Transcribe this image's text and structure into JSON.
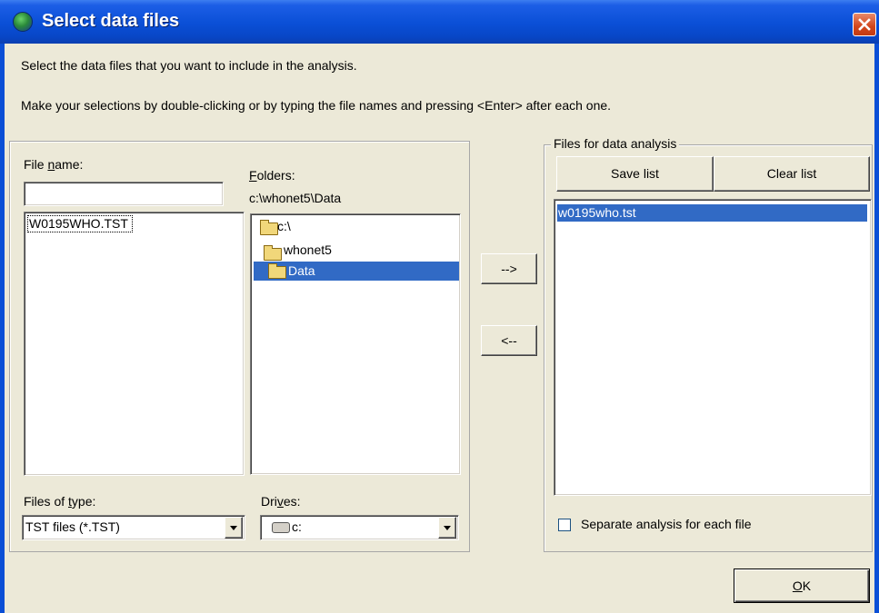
{
  "window": {
    "title": "Select data files",
    "icon": "whonet-globe-icon",
    "close_icon": "close-icon"
  },
  "instructions": {
    "line1": "Select the data files that you want to include in the analysis.",
    "line2": "Make your selections by double-clicking or by typing the file names and pressing <Enter> after each one."
  },
  "left_panel": {
    "file_name_label_pre": "File ",
    "file_name_label_underline": "n",
    "file_name_label_post": "ame:",
    "file_name_value": "",
    "files": [
      "W0195WHO.TST"
    ],
    "folders_label_underline": "F",
    "folders_label_post": "olders:",
    "current_path": "c:\\whonet5\\Data",
    "folders": [
      {
        "name": "c:\\",
        "selected": false
      },
      {
        "name": "whonet5",
        "selected": false
      },
      {
        "name": "Data",
        "selected": true
      }
    ],
    "files_of_type_label_pre": "Files of ",
    "files_of_type_label_underline": "t",
    "files_of_type_label_post": "ype:",
    "files_of_type_value": "TST files (*.TST)",
    "drives_label_pre": "Dri",
    "drives_label_underline": "v",
    "drives_label_post": "es:",
    "drives_value": "c:"
  },
  "transfer": {
    "add_label": "-->",
    "remove_label": "<--"
  },
  "right_panel": {
    "group_title": "Files for data analysis",
    "save_list_label": "Save list",
    "clear_list_label": "Clear list",
    "selected_files": [
      "w0195who.tst"
    ],
    "separate_analysis_label": "Separate analysis for each file",
    "separate_analysis_checked": false
  },
  "footer": {
    "ok_label_underline": "O",
    "ok_label_post": "K"
  }
}
